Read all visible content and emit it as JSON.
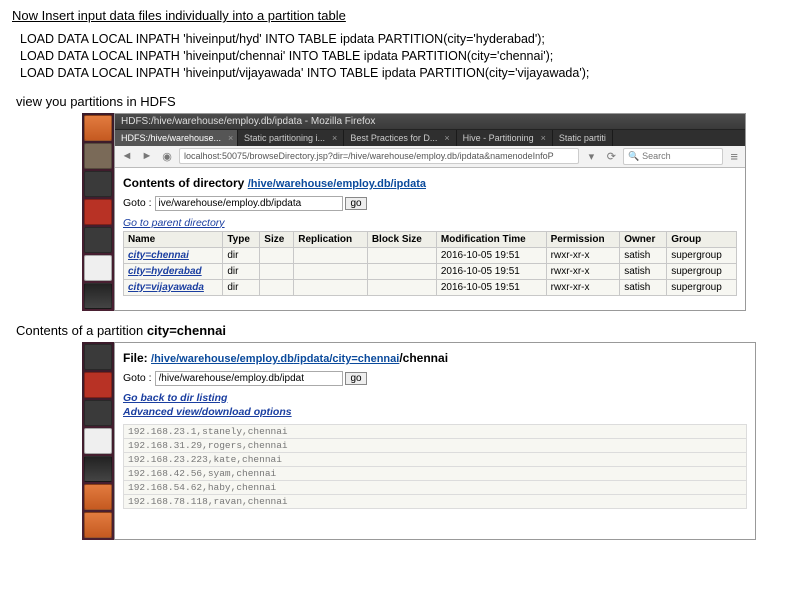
{
  "intro": "Now Insert input data files individually into a partition table",
  "sql": {
    "l1": "LOAD DATA LOCAL INPATH 'hiveinput/hyd'   INTO TABLE ipdata PARTITION(city='hyderabad');",
    "l2": "LOAD DATA LOCAL INPATH 'hiveinput/chennai'   INTO TABLE ipdata PARTITION(city='chennai');",
    "l3": "LOAD DATA LOCAL INPATH 'hiveinput/vijayawada'   INTO TABLE ipdata PARTITION(city='vijayawada');"
  },
  "view_label": "view you partitions in HDFS",
  "contents_label_prefix": "Contents of a partition ",
  "contents_label_bold": "city=chennai",
  "ss1": {
    "window_title": "HDFS:/hive/warehouse/employ.db/ipdata - Mozilla Firefox",
    "tabs": [
      "HDFS:/hive/warehouse...",
      "Static partitioning i...",
      "Best Practices for D...",
      "Hive - Partitioning",
      "Static partiti"
    ],
    "url": "localhost:50075/browseDirectory.jsp?dir=/hive/warehouse/employ.db/ipdata&namenodeInfoP",
    "search_placeholder": "Search",
    "dir_heading_prefix": "Contents of directory ",
    "dir_path": {
      "p1": "/hive",
      "p2": "/warehouse",
      "p3": "/employ.db",
      "p4": "/ipdata"
    },
    "goto_label": "Goto : ",
    "goto_value": "ive/warehouse/employ.db/ipdata",
    "go_btn": "go",
    "parent_link": "Go to parent directory",
    "headers": [
      "Name",
      "Type",
      "Size",
      "Replication",
      "Block Size",
      "Modification Time",
      "Permission",
      "Owner",
      "Group"
    ],
    "rows": [
      {
        "name": "city=chennai",
        "type": "dir",
        "size": "",
        "rep": "",
        "bs": "",
        "mtime": "2016-10-05 19:51",
        "perm": "rwxr-xr-x",
        "owner": "satish",
        "group": "supergroup"
      },
      {
        "name": "city=hyderabad",
        "type": "dir",
        "size": "",
        "rep": "",
        "bs": "",
        "mtime": "2016-10-05 19:51",
        "perm": "rwxr-xr-x",
        "owner": "satish",
        "group": "supergroup"
      },
      {
        "name": "city=vijayawada",
        "type": "dir",
        "size": "",
        "rep": "",
        "bs": "",
        "mtime": "2016-10-05 19:51",
        "perm": "rwxr-xr-x",
        "owner": "satish",
        "group": "supergroup"
      }
    ]
  },
  "ss2": {
    "file_label": "File: ",
    "path": {
      "p1": "/hive",
      "p2": "/warehouse",
      "p3": "/employ.db",
      "p4": "/ipdata",
      "p5": "/city=chennai",
      "p6": "/chennai"
    },
    "goto_label": "Goto : ",
    "goto_value": "/hive/warehouse/employ.db/ipdat",
    "go_btn": "go",
    "back_link": "Go back to dir listing",
    "adv_link": "Advanced view/download options",
    "rows": [
      "192.168.23.1,stanely,chennai",
      "192.168.31.29,rogers,chennai",
      "192.168.23.223,kate,chennai",
      "192.168.42.56,syam,chennai",
      "192.168.54.62,haby,chennai",
      "192.168.78.118,ravan,chennai"
    ]
  }
}
